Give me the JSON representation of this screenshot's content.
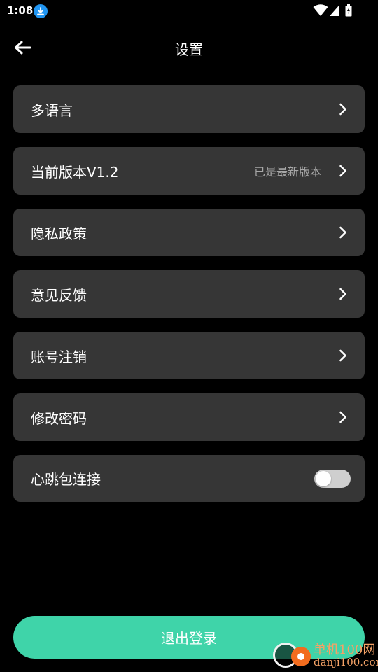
{
  "status_bar": {
    "time": "1:08",
    "icons": [
      "download-icon",
      "wifi-icon",
      "signal-icon",
      "battery-icon"
    ]
  },
  "header": {
    "title": "设置",
    "back_icon": "arrow-left-icon"
  },
  "settings": {
    "items": [
      {
        "label": "多语言"
      },
      {
        "label": "当前版本V1.2",
        "value": "已是最新版本"
      },
      {
        "label": "隐私政策"
      },
      {
        "label": "意见反馈"
      },
      {
        "label": "账号注销"
      },
      {
        "label": "修改密码"
      },
      {
        "label": "心跳包连接",
        "toggle": false
      }
    ]
  },
  "logout": {
    "label": "退出登录"
  },
  "watermark": {
    "line1": "单机100网",
    "line2": "danji100.com"
  },
  "colors": {
    "background": "#000000",
    "row_background": "#363636",
    "accent": "#3fd4a9",
    "secondary_text": "#a8a8a8"
  }
}
